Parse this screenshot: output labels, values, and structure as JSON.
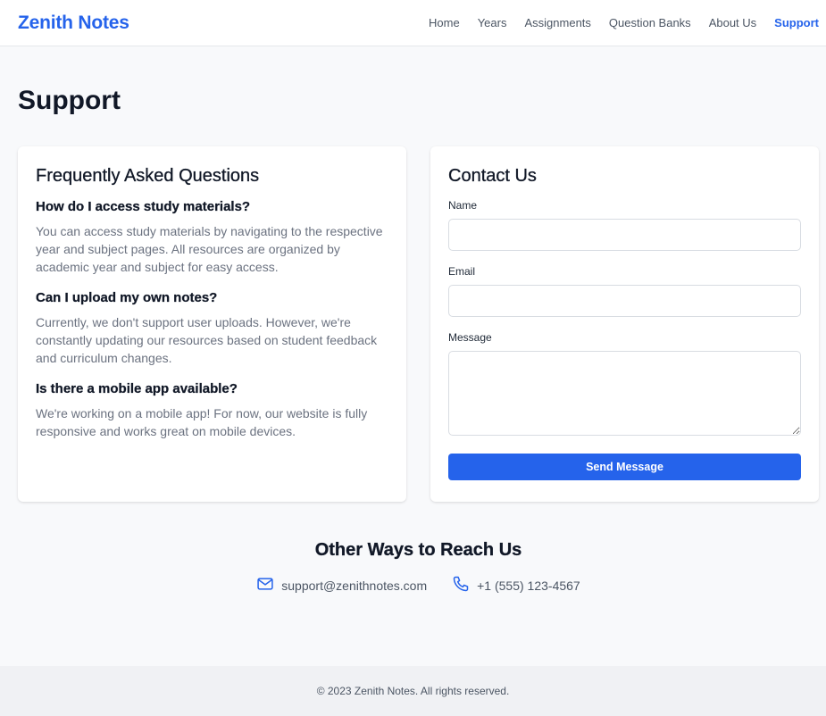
{
  "header": {
    "brand": "Zenith Notes",
    "nav": [
      {
        "label": "Home"
      },
      {
        "label": "Years"
      },
      {
        "label": "Assignments"
      },
      {
        "label": "Question Banks"
      },
      {
        "label": "About Us"
      },
      {
        "label": "Support",
        "active": true
      }
    ]
  },
  "page": {
    "title": "Support"
  },
  "faq": {
    "title": "Frequently Asked Questions",
    "items": [
      {
        "question": "How do I access study materials?",
        "answer": "You can access study materials by navigating to the respective year and subject pages. All resources are organized by academic year and subject for easy access."
      },
      {
        "question": "Can I upload my own notes?",
        "answer": "Currently, we don't support user uploads. However, we're constantly updating our resources based on student feedback and curriculum changes."
      },
      {
        "question": "Is there a mobile app available?",
        "answer": "We're working on a mobile app! For now, our website is fully responsive and works great on mobile devices."
      }
    ]
  },
  "contact": {
    "title": "Contact Us",
    "name_label": "Name",
    "name_value": "",
    "email_label": "Email",
    "email_value": "",
    "message_label": "Message",
    "message_value": "",
    "submit_label": "Send Message"
  },
  "other": {
    "title": "Other Ways to Reach Us",
    "email": "support@zenithnotes.com",
    "email_icon": "mail-icon",
    "phone": "+1 (555) 123-4567",
    "phone_icon": "phone-icon"
  },
  "footer": {
    "text": "© 2023 Zenith Notes. All rights reserved."
  },
  "colors": {
    "accent": "#2563eb",
    "background": "#f8f9fb",
    "text": "#111827",
    "muted": "#6b7280"
  }
}
